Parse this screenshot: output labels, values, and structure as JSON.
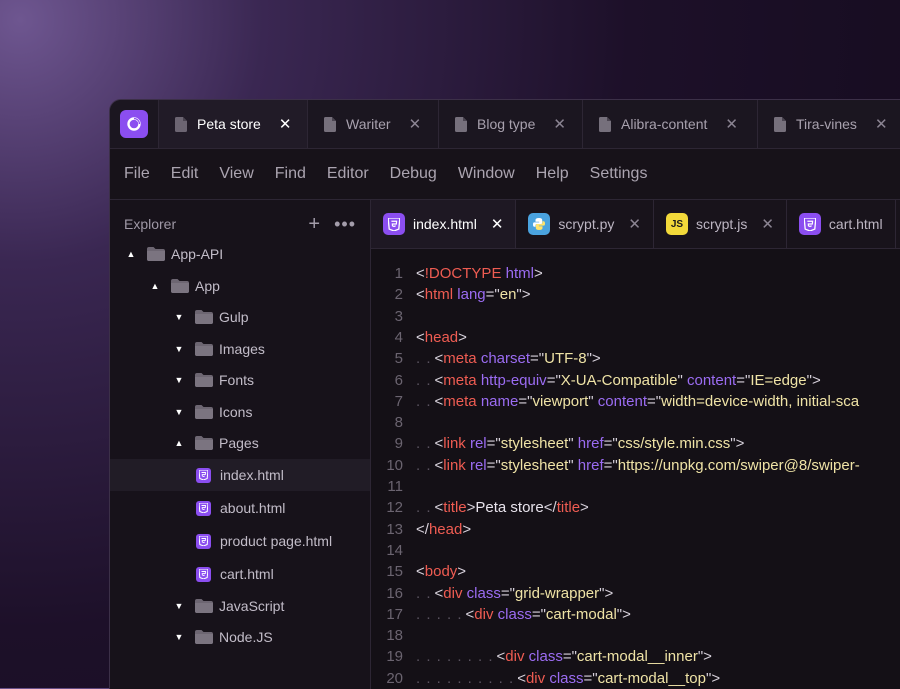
{
  "window_tabs": [
    {
      "label": "Peta store",
      "active": true
    },
    {
      "label": "Wariter",
      "active": false
    },
    {
      "label": "Blog type",
      "active": false
    },
    {
      "label": "Alibra-content",
      "active": false
    },
    {
      "label": "Tira-vines",
      "active": false
    }
  ],
  "menu": [
    "File",
    "Edit",
    "View",
    "Find",
    "Editor",
    "Debug",
    "Window",
    "Help",
    "Settings"
  ],
  "sidebar": {
    "title": "Explorer",
    "add_icon": "plus-icon",
    "more_icon": "more-icon",
    "tree": [
      {
        "label": "App-API",
        "type": "folder",
        "depth": 0,
        "expanded": true
      },
      {
        "label": "App",
        "type": "folder",
        "depth": 1,
        "expanded": true
      },
      {
        "label": "Gulp",
        "type": "folder",
        "depth": 2,
        "expanded": false
      },
      {
        "label": "Images",
        "type": "folder",
        "depth": 2,
        "expanded": false
      },
      {
        "label": "Fonts",
        "type": "folder",
        "depth": 2,
        "expanded": false
      },
      {
        "label": "Icons",
        "type": "folder",
        "depth": 2,
        "expanded": false
      },
      {
        "label": "Pages",
        "type": "folder",
        "depth": 2,
        "expanded": true
      },
      {
        "label": "index.html",
        "type": "html",
        "depth": 3,
        "selected": true
      },
      {
        "label": "about.html",
        "type": "html",
        "depth": 3
      },
      {
        "label": "product page.html",
        "type": "html",
        "depth": 3
      },
      {
        "label": "cart.html",
        "type": "html",
        "depth": 3
      },
      {
        "label": "JavaScript",
        "type": "folder",
        "depth": 2,
        "expanded": false
      },
      {
        "label": "Node.JS",
        "type": "folder",
        "depth": 2,
        "expanded": false
      }
    ]
  },
  "editor_tabs": [
    {
      "label": "index.html",
      "icon": "html",
      "badge": "5",
      "active": true,
      "closable": true
    },
    {
      "label": "scrypt.py",
      "icon": "py",
      "badge": "",
      "active": false,
      "closable": true
    },
    {
      "label": "scrypt.js",
      "icon": "js",
      "badge": "JS",
      "active": false,
      "closable": true
    },
    {
      "label": "cart.html",
      "icon": "html",
      "badge": "5",
      "active": false,
      "closable": false
    }
  ],
  "code_lines": [
    {
      "n": "1",
      "indent": "",
      "tokens": [
        [
          "punct",
          "<"
        ],
        [
          "tag",
          "!DOCTYPE"
        ],
        [
          "punct",
          " "
        ],
        [
          "attr",
          "html"
        ],
        [
          "punct",
          ">"
        ]
      ]
    },
    {
      "n": "2",
      "indent": "",
      "tokens": [
        [
          "punct",
          "<"
        ],
        [
          "tag",
          "html"
        ],
        [
          "punct",
          " "
        ],
        [
          "attr",
          "lang"
        ],
        [
          "punct",
          "=\""
        ],
        [
          "str",
          "en"
        ],
        [
          "punct",
          "\">"
        ]
      ]
    },
    {
      "n": "3",
      "indent": "",
      "tokens": []
    },
    {
      "n": "4",
      "indent": "",
      "tokens": [
        [
          "punct",
          "<"
        ],
        [
          "tag",
          "head"
        ],
        [
          "punct",
          ">"
        ]
      ]
    },
    {
      "n": "5",
      "indent": ". .",
      "tokens": [
        [
          "punct",
          "<"
        ],
        [
          "tag",
          "meta"
        ],
        [
          "punct",
          " "
        ],
        [
          "attr",
          "charset"
        ],
        [
          "punct",
          "=\""
        ],
        [
          "str",
          "UTF-8"
        ],
        [
          "punct",
          "\">"
        ]
      ]
    },
    {
      "n": "6",
      "indent": ". .",
      "tokens": [
        [
          "punct",
          "<"
        ],
        [
          "tag",
          "meta"
        ],
        [
          "punct",
          " "
        ],
        [
          "attr",
          "http-equiv"
        ],
        [
          "punct",
          "=\""
        ],
        [
          "str",
          "X-UA-Compatible"
        ],
        [
          "punct",
          "\" "
        ],
        [
          "attr",
          "content"
        ],
        [
          "punct",
          "=\""
        ],
        [
          "str",
          "IE=edge"
        ],
        [
          "punct",
          "\">"
        ]
      ]
    },
    {
      "n": "7",
      "indent": ". .",
      "tokens": [
        [
          "punct",
          "<"
        ],
        [
          "tag",
          "meta"
        ],
        [
          "punct",
          " "
        ],
        [
          "attr",
          "name"
        ],
        [
          "punct",
          "=\""
        ],
        [
          "str",
          "viewport"
        ],
        [
          "punct",
          "\" "
        ],
        [
          "attr",
          "content"
        ],
        [
          "punct",
          "=\""
        ],
        [
          "str",
          "width=device-width, initial-sca"
        ]
      ]
    },
    {
      "n": "8",
      "indent": "",
      "tokens": []
    },
    {
      "n": "9",
      "indent": ". .",
      "tokens": [
        [
          "punct",
          "<"
        ],
        [
          "tag",
          "link"
        ],
        [
          "punct",
          " "
        ],
        [
          "attr",
          "rel"
        ],
        [
          "punct",
          "=\""
        ],
        [
          "str",
          "stylesheet"
        ],
        [
          "punct",
          "\" "
        ],
        [
          "attr",
          "href"
        ],
        [
          "punct",
          "=\""
        ],
        [
          "str",
          "css/style.min.css"
        ],
        [
          "punct",
          "\">"
        ]
      ]
    },
    {
      "n": "10",
      "indent": ". .",
      "tokens": [
        [
          "punct",
          "<"
        ],
        [
          "tag",
          "link"
        ],
        [
          "punct",
          " "
        ],
        [
          "attr",
          "rel"
        ],
        [
          "punct",
          "=\""
        ],
        [
          "str",
          "stylesheet"
        ],
        [
          "punct",
          "\" "
        ],
        [
          "attr",
          "href"
        ],
        [
          "punct",
          "=\""
        ],
        [
          "str",
          "https://unpkg.com/swiper@8/swiper-"
        ]
      ]
    },
    {
      "n": "11",
      "indent": "",
      "tokens": []
    },
    {
      "n": "12",
      "indent": ". .",
      "tokens": [
        [
          "punct",
          "<"
        ],
        [
          "tag",
          "title"
        ],
        [
          "punct",
          ">"
        ],
        [
          "text",
          "Peta store"
        ],
        [
          "punct",
          "</"
        ],
        [
          "tag",
          "title"
        ],
        [
          "punct",
          ">"
        ]
      ]
    },
    {
      "n": "13",
      "indent": "",
      "tokens": [
        [
          "punct",
          "</"
        ],
        [
          "tag",
          "head"
        ],
        [
          "punct",
          ">"
        ]
      ]
    },
    {
      "n": "14",
      "indent": "",
      "tokens": []
    },
    {
      "n": "15",
      "indent": "",
      "tokens": [
        [
          "punct",
          "<"
        ],
        [
          "tag",
          "body"
        ],
        [
          "punct",
          ">"
        ]
      ]
    },
    {
      "n": "16",
      "indent": ". .",
      "tokens": [
        [
          "punct",
          "<"
        ],
        [
          "tag",
          "div"
        ],
        [
          "punct",
          " "
        ],
        [
          "attr",
          "class"
        ],
        [
          "punct",
          "=\""
        ],
        [
          "str",
          "grid-wrapper"
        ],
        [
          "punct",
          "\">"
        ]
      ]
    },
    {
      "n": "17",
      "indent": ". . . . .",
      "tokens": [
        [
          "punct",
          "<"
        ],
        [
          "tag",
          "div"
        ],
        [
          "punct",
          " "
        ],
        [
          "attr",
          "class"
        ],
        [
          "punct",
          "=\""
        ],
        [
          "str",
          "cart-modal"
        ],
        [
          "punct",
          "\">"
        ]
      ]
    },
    {
      "n": "18",
      "indent": "",
      "tokens": []
    },
    {
      "n": "19",
      "indent": ". . . . . . . .",
      "tokens": [
        [
          "punct",
          "<"
        ],
        [
          "tag",
          "div"
        ],
        [
          "punct",
          " "
        ],
        [
          "attr",
          "class"
        ],
        [
          "punct",
          "=\""
        ],
        [
          "str",
          "cart-modal__inner"
        ],
        [
          "punct",
          "\">"
        ]
      ]
    },
    {
      "n": "20",
      "indent": ". . . . . . . . . .",
      "tokens": [
        [
          "punct",
          "<"
        ],
        [
          "tag",
          "div"
        ],
        [
          "punct",
          " "
        ],
        [
          "attr",
          "class"
        ],
        [
          "punct",
          "=\""
        ],
        [
          "str",
          "cart-modal__top"
        ],
        [
          "punct",
          "\">"
        ]
      ]
    }
  ],
  "colors": {
    "accent": "#8b4ef0",
    "tag": "#ef5c52",
    "attr": "#9b6cf2",
    "string": "#efe3a6"
  }
}
